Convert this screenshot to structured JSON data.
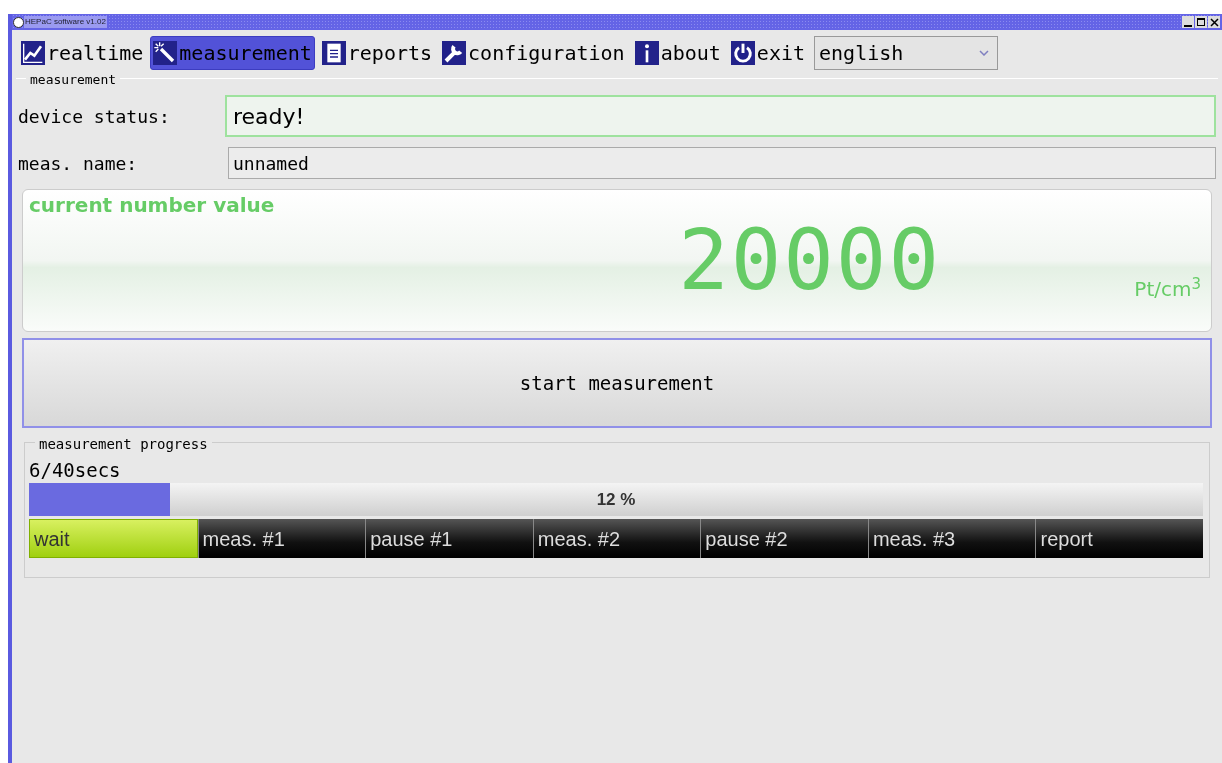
{
  "window": {
    "title": "HEPaC software v1.02"
  },
  "menu": [
    {
      "label": "realtime",
      "selected": false
    },
    {
      "label": "measurement",
      "selected": true
    },
    {
      "label": "reports",
      "selected": false
    },
    {
      "label": "configuration",
      "selected": false
    },
    {
      "label": "about",
      "selected": false
    },
    {
      "label": "exit",
      "selected": false
    }
  ],
  "language": {
    "value": "english"
  },
  "measurement": {
    "title": "measurement",
    "device_status": {
      "label": "device status:",
      "value": "ready!"
    },
    "meas_name": {
      "label": "meas. name:",
      "value": "unnamed"
    },
    "current_value": {
      "title": "current number value",
      "value": "20000",
      "unit": "Pt/cm$^{3}$"
    },
    "start_button": "start measurement"
  },
  "progress": {
    "title": "measurement progress",
    "time": "6/40secs",
    "level": 0.12,
    "percent": "12 %",
    "steps": [
      {
        "label": "wait",
        "active": true
      },
      {
        "label": "meas. #1",
        "active": false
      },
      {
        "label": "pause #1",
        "active": false
      },
      {
        "label": "meas. #2",
        "active": false
      },
      {
        "label": "pause #2",
        "active": false
      },
      {
        "label": "meas. #3",
        "active": false
      },
      {
        "label": "report",
        "active": false
      }
    ]
  }
}
